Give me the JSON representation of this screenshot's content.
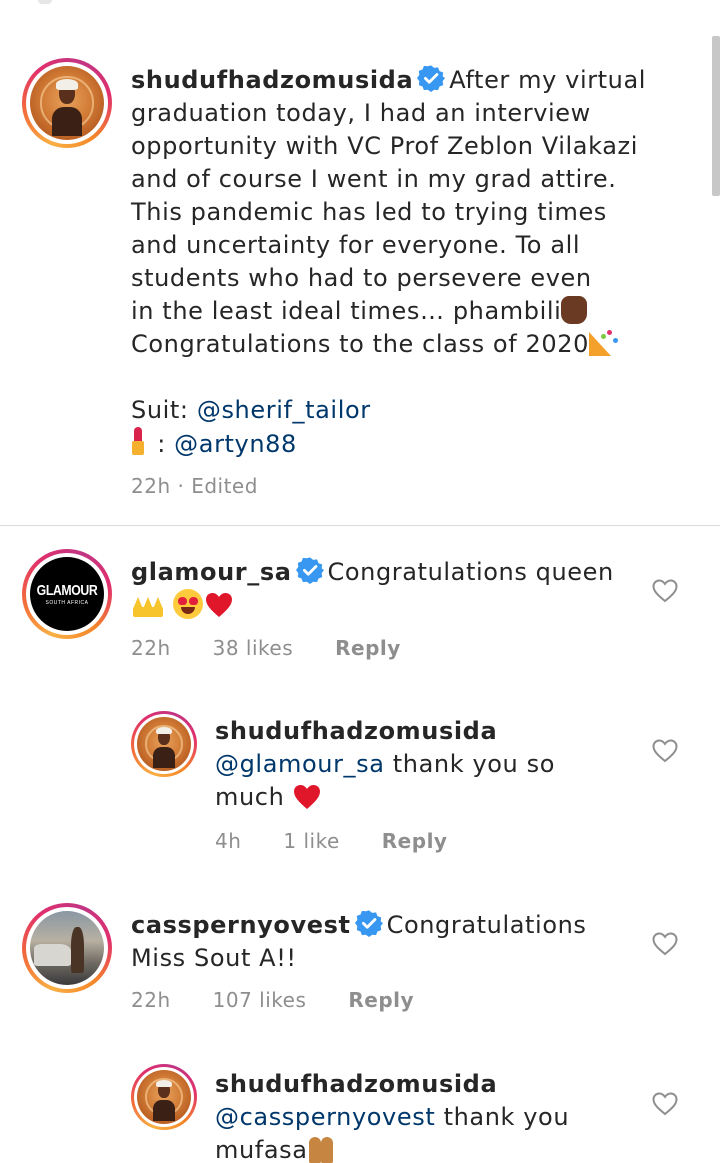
{
  "post": {
    "username": "shudufhadzomusida",
    "caption_lines": [
      "After my virtual",
      "graduation today, I had an interview",
      "opportunity with VC Prof Zeblon Vilakazi",
      "and of course I went in my grad attire.",
      "This pandemic has led to trying times",
      "and uncertainty for everyone. To all",
      "students who had to persevere even",
      "in the least ideal times… phambili",
      "Congratulations to the class of 2020"
    ],
    "suit_label": "Suit: ",
    "suit_mention": "@sherif_tailor",
    "makeup_sep": " : ",
    "makeup_mention": "@artyn88",
    "time": "22h · Edited"
  },
  "comments": [
    {
      "username": "glamour_sa",
      "text": "Congratulations queen",
      "time": "22h",
      "likes": "38 likes",
      "reply": "Reply",
      "avatar_logo": "GLAMOUR",
      "avatar_sub": "SOUTH AFRICA"
    },
    {
      "username": "shudufhadzomusida",
      "mention": "@glamour_sa",
      "text": " thank you so",
      "text2": "much ",
      "time": "4h",
      "likes": "1 like",
      "reply": "Reply"
    },
    {
      "username": "cassperny ovest",
      "username_display": "casspernyovest",
      "text": "Congratulations",
      "text2": "Miss Sout A!!",
      "time": "22h",
      "likes": "107 likes",
      "reply": "Reply"
    },
    {
      "username": "shudufhadzomusida",
      "mention": "@casspernyovest",
      "text": " thank you",
      "text2": "mufasa"
    }
  ],
  "colors": {
    "text": "#262626",
    "mention": "#00376b",
    "meta": "#8e8e8e",
    "verified": "#3897f0",
    "divider": "#dbdbdb"
  }
}
